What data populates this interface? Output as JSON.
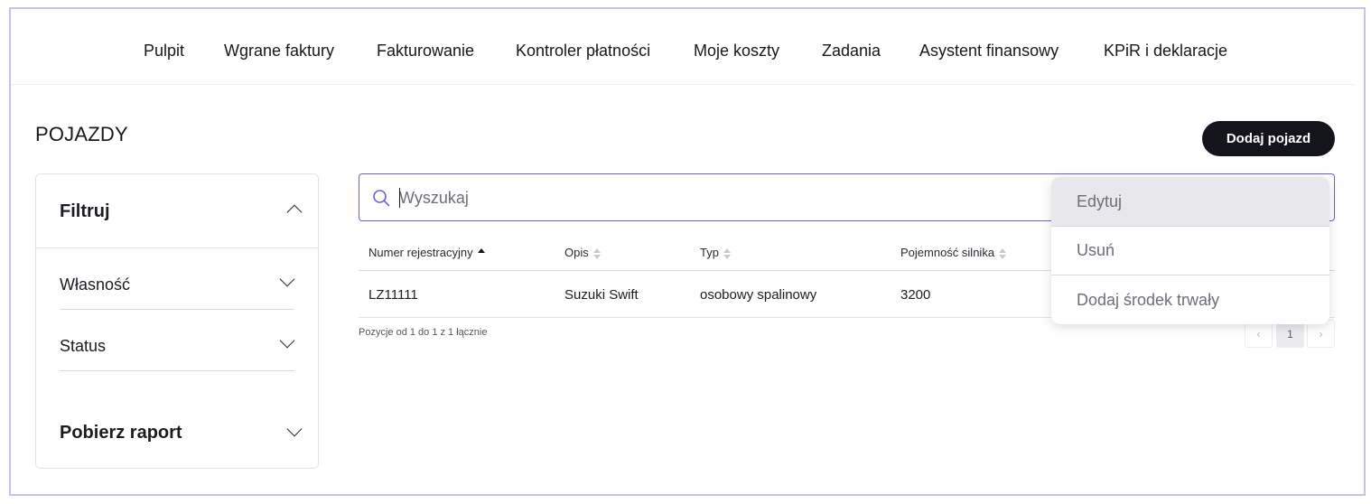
{
  "nav": {
    "items": [
      "Pulpit",
      "Wgrane faktury",
      "Fakturowanie",
      "Kontroler płatności",
      "Moje koszty",
      "Zadania",
      "Asystent finansowy",
      "KPiR i deklaracje"
    ]
  },
  "page": {
    "title": "POJAZDY",
    "add_button": "Dodaj pojazd"
  },
  "filters": {
    "title": "Filtruj",
    "items": [
      "Własność",
      "Status"
    ],
    "report": "Pobierz raport"
  },
  "search": {
    "placeholder": "Wyszukaj",
    "value": ""
  },
  "table": {
    "columns": [
      "Numer rejestracyjny",
      "Opis",
      "Typ",
      "Pojemność silnika"
    ],
    "sorted_column": "Numer rejestracyjny",
    "sort_direction": "asc",
    "rows": [
      [
        "LZ11111",
        "Suzuki Swift",
        "osobowy spalinowy",
        "3200"
      ]
    ]
  },
  "pagination": {
    "summary": "Pozycje od 1 do 1 z 1 łącznie",
    "prev": "‹",
    "current_page": "1",
    "next": "›"
  },
  "row_menu": {
    "items": [
      "Edytuj",
      "Usuń",
      "Dodaj środek trwały"
    ],
    "highlighted": "Edytuj"
  },
  "colors": {
    "accent_border": "#6f5fd0",
    "frame_border": "#c9c0ec",
    "primary_button": "#14141c",
    "menu_highlight": "#e7e7ec"
  }
}
